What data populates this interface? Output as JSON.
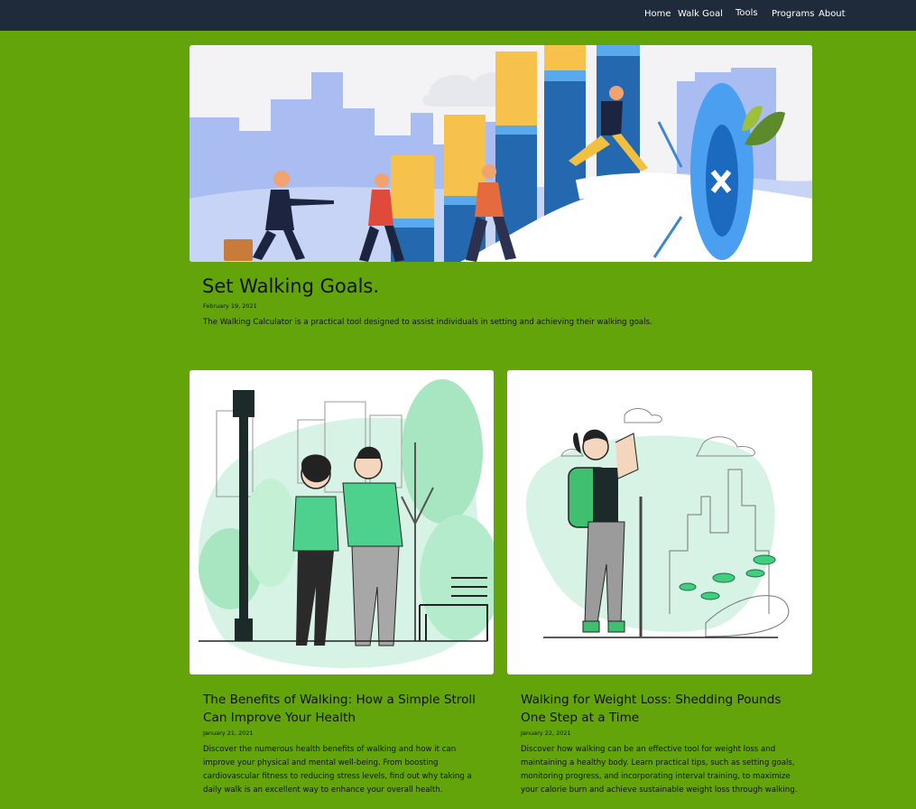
{
  "nav": {
    "items": [
      {
        "label": "Home"
      },
      {
        "label": "Walk Goal"
      },
      {
        "label": "Tools"
      },
      {
        "label": "Programs"
      },
      {
        "label": "About"
      }
    ]
  },
  "featured": {
    "title": "Set Walking Goals.",
    "date": "February 19, 2021",
    "excerpt": "The Walking Calculator is a practical tool designed to assist individuals in setting and achieving their walking goals."
  },
  "posts": [
    {
      "title": "The Benefits of Walking: How a Simple Stroll Can Improve Your Health",
      "date": "January 21, 2021",
      "excerpt": "Discover the numerous health benefits of walking and how it can improve your physical and mental well-being. From boosting cardiovascular fitness to reducing stress levels, find out why taking a daily walk is an excellent way to enhance your overall health."
    },
    {
      "title": "Walking for Weight Loss: Shedding Pounds One Step at a Time",
      "date": "January 22, 2021",
      "excerpt": "Discover how walking can be an effective tool for weight loss and maintaining a healthy body. Learn practical tips, such as setting goals, monitoring progress, and incorporating interval training, to maximize your calorie burn and achieve sustainable weight loss through walking."
    }
  ],
  "colors": {
    "page_background": "#63a40a",
    "navbar_background": "#1f2a3b"
  }
}
